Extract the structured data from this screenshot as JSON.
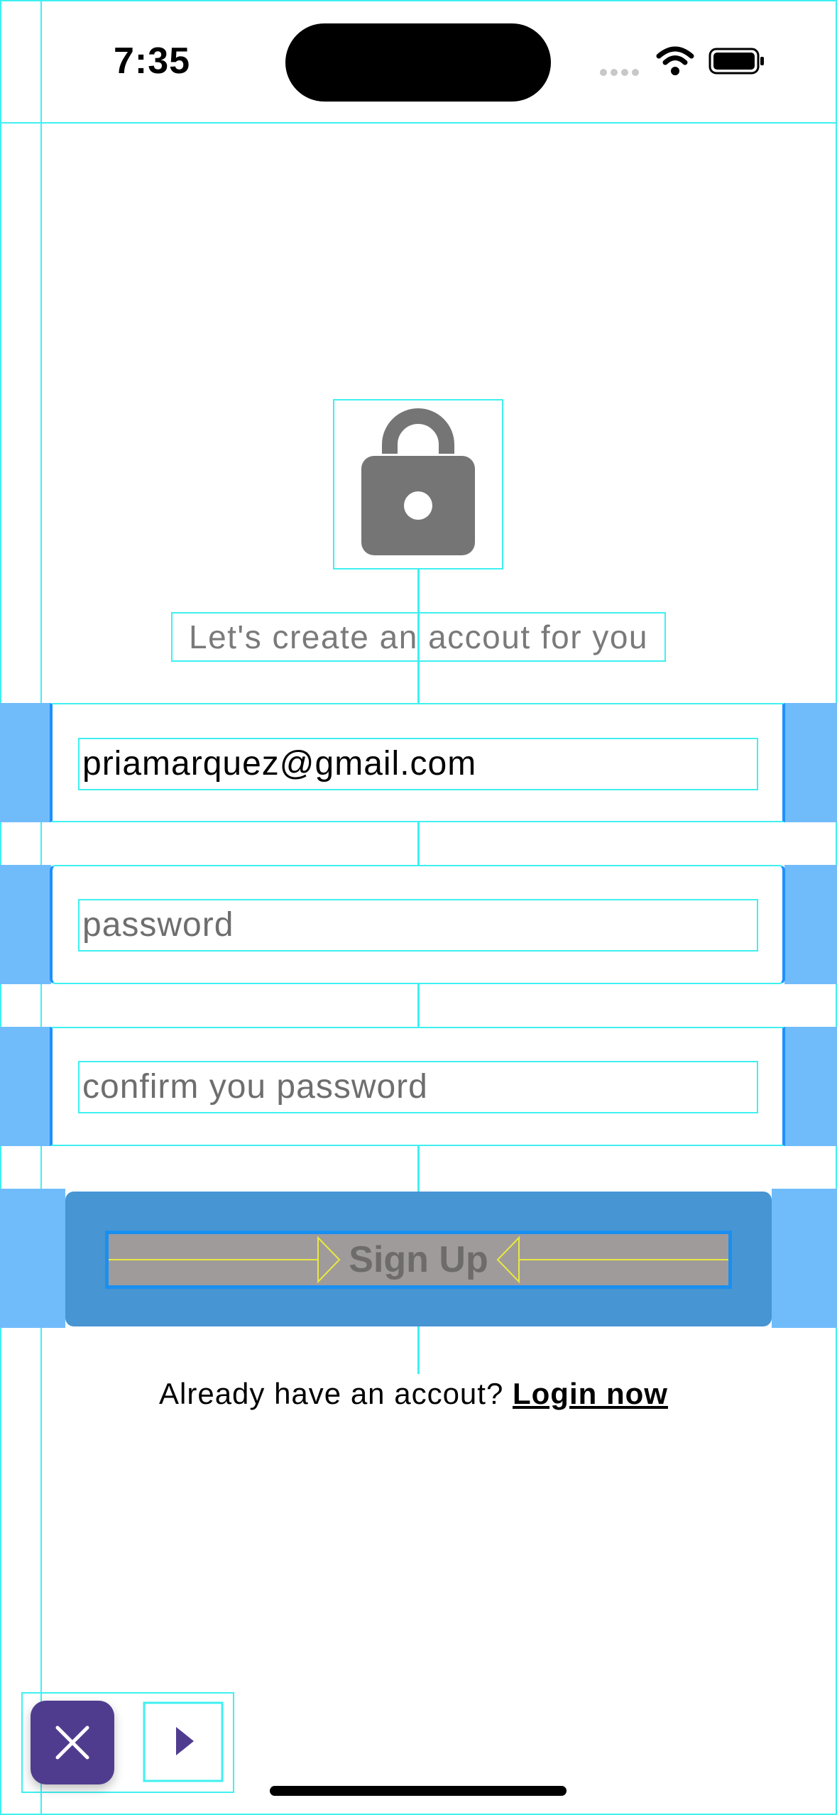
{
  "status_bar": {
    "time": "7:35",
    "icons": [
      "cellular-signal-icon",
      "wifi-icon",
      "battery-icon"
    ]
  },
  "hero": {
    "icon": "lock-icon",
    "subtitle": "Let's create an accout for you"
  },
  "form": {
    "email": {
      "value": "priamarquez@gmail.com"
    },
    "password": {
      "placeholder": "password"
    },
    "confirm_password": {
      "placeholder": "confirm you password"
    }
  },
  "signup_button": {
    "label": "Sign Up"
  },
  "login_prompt": {
    "text": "Already have an accout?",
    "link": "Login now"
  },
  "debug_toolbar": {
    "icons": [
      "close-icon",
      "play-icon"
    ]
  },
  "colors": {
    "accent_band": "#70bcfb",
    "button_panel": "#4795d3",
    "button_inner": "#a09b9b",
    "debug_outline": "#3ff0f0",
    "debug_button": "#503c8f",
    "icon_gray": "#757575"
  }
}
